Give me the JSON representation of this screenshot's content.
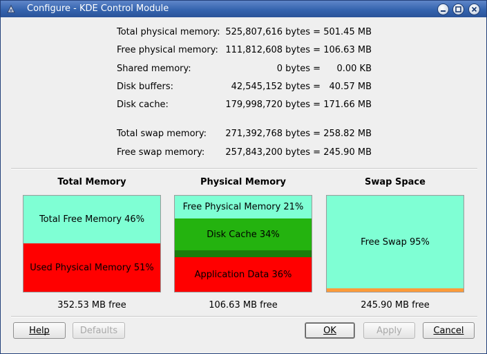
{
  "window": {
    "title": "Configure - KDE Control Module",
    "app_icon": "kde-config-icon",
    "controls": [
      "minimize-icon",
      "maximize-icon",
      "close-icon"
    ]
  },
  "memory_info": {
    "rows": [
      {
        "label": "Total physical memory:",
        "bytes": "525,807,616 bytes =",
        "mb": "501.45 MB"
      },
      {
        "label": "Free physical memory:",
        "bytes": "111,812,608 bytes =",
        "mb": "106.63 MB"
      },
      {
        "label": "Shared memory:",
        "bytes": "0 bytes =",
        "mb": "0.00 KB"
      },
      {
        "label": "Disk buffers:",
        "bytes": "42,545,152 bytes =",
        "mb": "40.57 MB"
      },
      {
        "label": "Disk cache:",
        "bytes": "179,998,720 bytes =",
        "mb": "171.66 MB"
      },
      {
        "label": "Total swap memory:",
        "bytes": "271,392,768 bytes =",
        "mb": "258.82 MB"
      },
      {
        "label": "Free swap memory:",
        "bytes": "257,843,200 bytes =",
        "mb": "245.90 MB"
      }
    ]
  },
  "charts": [
    {
      "title": "Total Memory",
      "free_text": "352.53 MB free",
      "segments": [
        {
          "label": "Total Free Memory 46%",
          "fraction": 0.495,
          "color": "#7fffd4"
        },
        {
          "label": "Used Physical Memory 51%",
          "fraction": 0.505,
          "color": "#ff0000"
        }
      ]
    },
    {
      "title": "Physical Memory",
      "free_text": "106.63 MB free",
      "segments": [
        {
          "label": "Free Physical Memory 21%",
          "fraction": 0.24,
          "color": "#7fffd4"
        },
        {
          "label": "Disk Cache 34%",
          "fraction": 0.33,
          "color": "#24b30f"
        },
        {
          "label": "",
          "fraction": 0.075,
          "color": "#1b7d0c"
        },
        {
          "label": "Application Data 36%",
          "fraction": 0.355,
          "color": "#ff0000"
        }
      ]
    },
    {
      "title": "Swap Space",
      "free_text": "245.90 MB free",
      "segments": [
        {
          "label": "Free Swap 95%",
          "fraction": 0.965,
          "color": "#7fffd4"
        },
        {
          "label": "",
          "fraction": 0.035,
          "color": "#ff9b3a"
        }
      ]
    }
  ],
  "buttons": {
    "help": "Help",
    "defaults": "Defaults",
    "ok": "OK",
    "apply": "Apply",
    "cancel": "Cancel"
  }
}
